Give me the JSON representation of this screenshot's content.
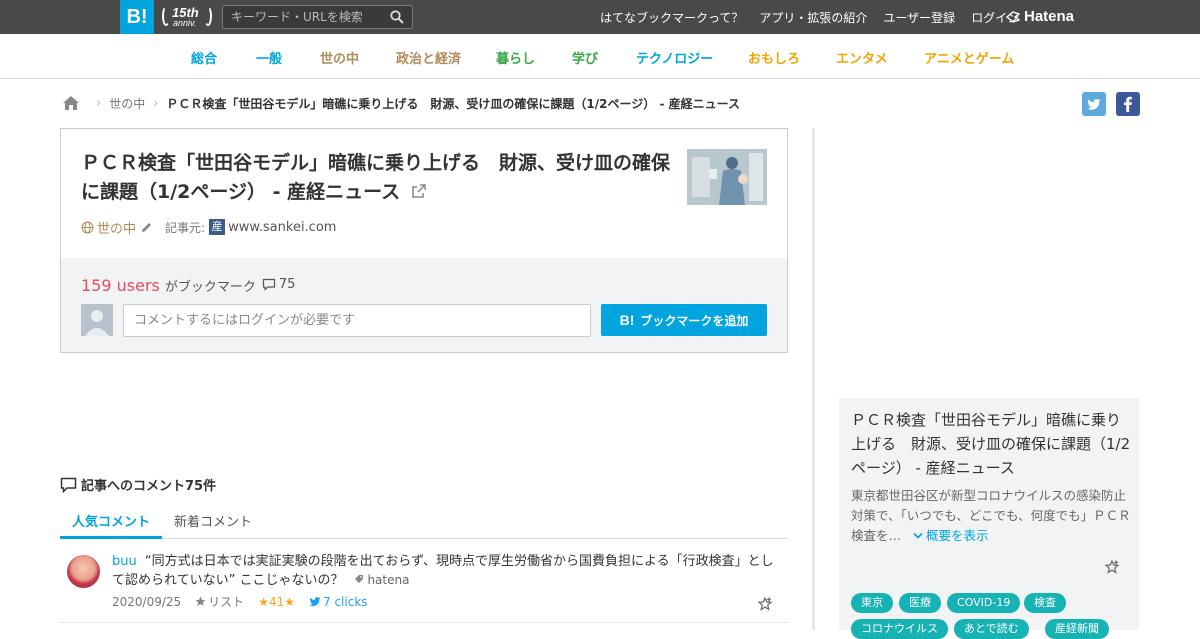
{
  "header": {
    "logo_text": "B!",
    "anniv_num": "15th",
    "anniv_sub": "anniv.",
    "search_placeholder": "キーワード・URLを検索",
    "links": [
      "はてなブックマークって？",
      "アプリ・拡張の紹介",
      "ユーザー登録",
      "ログイン"
    ],
    "brand": "Hatena"
  },
  "categories": [
    {
      "label": "総合",
      "color": "#00a4de"
    },
    {
      "label": "一般",
      "color": "#00a4de"
    },
    {
      "label": "世の中",
      "color": "#b08b5a"
    },
    {
      "label": "政治と経済",
      "color": "#b08b5a"
    },
    {
      "label": "暮らし",
      "color": "#3aa64a"
    },
    {
      "label": "学び",
      "color": "#3aa64a"
    },
    {
      "label": "テクノロジー",
      "color": "#00a4de"
    },
    {
      "label": "おもしろ",
      "color": "#f0a500"
    },
    {
      "label": "エンタメ",
      "color": "#f0a500"
    },
    {
      "label": "アニメとゲーム",
      "color": "#f0a500"
    }
  ],
  "breadcrumb": {
    "level1": "世の中",
    "current": "ＰＣＲ検査「世田谷モデル」暗礁に乗り上げる　財源、受け皿の確保に課題（1/2ページ） - 産経ニュース"
  },
  "entry": {
    "title": "ＰＣＲ検査「世田谷モデル」暗礁に乗り上げる　財源、受け皿の確保に課題（1/2ページ） - 産経ニュース",
    "category": "世の中",
    "source_label": "記事元:",
    "favicon_char": "産",
    "domain": "www.sankei.com",
    "users_count": "159 users",
    "users_label": "がブックマーク",
    "comment_count": "75",
    "comment_placeholder": "コメントするにはログインが必要です",
    "add_button": "ブックマークを追加",
    "add_button_icon": "B!"
  },
  "comments_section": {
    "heading": "記事へのコメント75件",
    "tabs": [
      "人気コメント",
      "新着コメント"
    ],
    "items": [
      {
        "user": "buu",
        "text": "“同方式は日本では実証実験の段階を出ておらず、現時点で厚生労働省から国費負担による「行政検査」として認められていない” ここじゃないの？",
        "tag": "hatena",
        "date": "2020/09/25",
        "list_label": "リスト",
        "stars": "41",
        "clicks": "7 clicks"
      }
    ]
  },
  "sidebar": {
    "title": "ＰＣＲ検査「世田谷モデル」暗礁に乗り上げる　財源、受け皿の確保に課題（1/2ページ） - 産経ニュース",
    "description": "東京都世田谷区が新型コロナウイルスの感染防止対策で、「いつでも、どこでも、何度でも」ＰＣＲ検査を…",
    "more_label": "概要を表示",
    "tags": [
      "東京",
      "医療",
      "COVID-19",
      "検査",
      "コロナウイルス",
      "あとで読む",
      "産経新聞"
    ]
  }
}
